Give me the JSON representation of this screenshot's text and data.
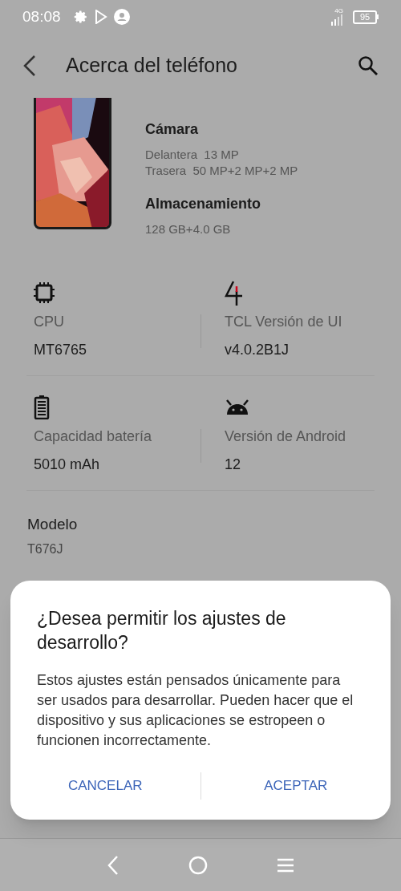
{
  "status_bar": {
    "time": "08:08",
    "network": "4G",
    "battery": "95"
  },
  "header": {
    "title": "Acerca del teléfono"
  },
  "specs": [
    {
      "title": "Cámara",
      "lines": [
        "Delantera  13 MP",
        "Trasera  50 MP+2 MP+2 MP"
      ]
    },
    {
      "title": "Almacenamiento",
      "lines": [
        "128 GB+4.0 GB"
      ]
    }
  ],
  "tiles": [
    {
      "kind": "chip",
      "label": "CPU",
      "value": "MT6765"
    },
    {
      "kind": "ui",
      "label": "TCL Versión de UI",
      "value": "v4.0.2B1J"
    },
    {
      "kind": "battery",
      "label": "Capacidad batería",
      "value": "5010 mAh"
    },
    {
      "kind": "android",
      "label": "Versión de Android",
      "value": "12"
    }
  ],
  "items": [
    {
      "title": "Modelo",
      "value": "T676J"
    }
  ],
  "dialog": {
    "title": "¿Desea permitir los ajustes de desarrollo?",
    "message": "Estos ajustes están pensados únicamente para ser usados para desarrollar. Pueden hacer que el dispositivo y sus aplicaciones se estropeen o funcionen incorrectamente.",
    "buttons": [
      "CANCELAR",
      "ACEPTAR"
    ]
  }
}
